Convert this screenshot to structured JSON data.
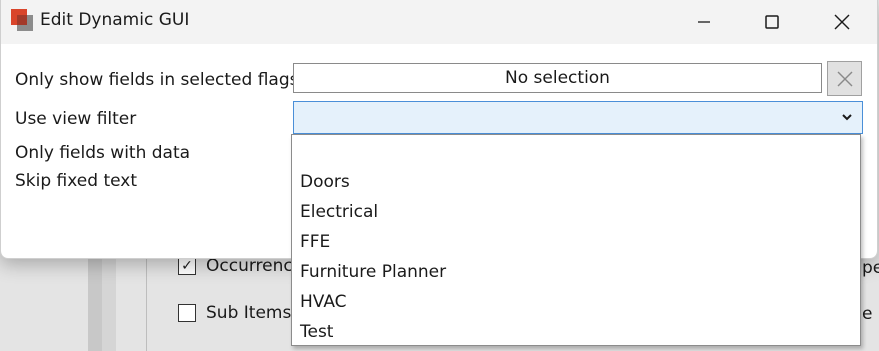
{
  "window": {
    "title": "Edit Dynamic GUI",
    "controls": {
      "minimize": "minimize-icon",
      "maximize": "maximize-icon",
      "close": "close-icon"
    }
  },
  "form": {
    "flags_label": "Only show fields in selected flags",
    "flags_value": "No selection",
    "view_filter_label": "Use view filter",
    "view_filter_value": "",
    "only_data_label": "Only fields with data",
    "skip_fixed_label": "Skip fixed text"
  },
  "dropdown": {
    "options": [
      "",
      "Doors",
      "Electrical",
      "FFE",
      "Furniture Planner",
      "HVAC",
      "Test"
    ]
  },
  "background": {
    "occurrence_label": "Occurrence",
    "occurrence_checked": true,
    "sub_items_label": "Sub Items",
    "sub_items_checked": false,
    "right_fragment_1": "pe",
    "right_fragment_2": "e"
  },
  "colors": {
    "accent": "#4a8fd8",
    "combo_bg": "#e5f1fb",
    "titlebar": "#f3f3f3"
  }
}
